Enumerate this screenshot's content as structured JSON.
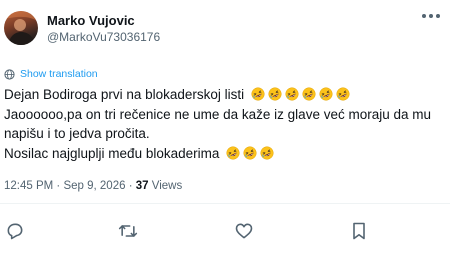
{
  "author": {
    "display_name": "Marko Vujovic",
    "handle": "@MarkoVu73036176"
  },
  "translation": {
    "label": "Show translation",
    "icon": "globe-icon"
  },
  "tweet": {
    "lines": [
      {
        "text": "Dejan Bodiroga prvi na blokaderskoj listi",
        "emoji_count": 6
      },
      {
        "text": "Jaoooooo,pa on tri rečenice ne ume da kaže iz glave već moraju da mu",
        "emoji_count": 0
      },
      {
        "text": "napišu i to jedva pročita.",
        "emoji_count": 0
      },
      {
        "text": "Nosilac najgluplji među blokaderima",
        "emoji_count": 3
      }
    ],
    "emoji_icon": "rolling-on-floor-laughing-emoji"
  },
  "meta": {
    "time": "12:45 PM",
    "separator": " · ",
    "date": "Sep 9, 2026",
    "views_count": "37",
    "views_label": " Views"
  },
  "actions": {
    "reply_icon": "reply-icon",
    "retweet_icon": "retweet-icon",
    "like_icon": "like-icon",
    "bookmark_icon": "bookmark-icon"
  },
  "colors": {
    "link": "#1d9bf0",
    "secondary_text": "#536471",
    "primary_text": "#0f1419",
    "emoji_face": "#fcc21b"
  }
}
